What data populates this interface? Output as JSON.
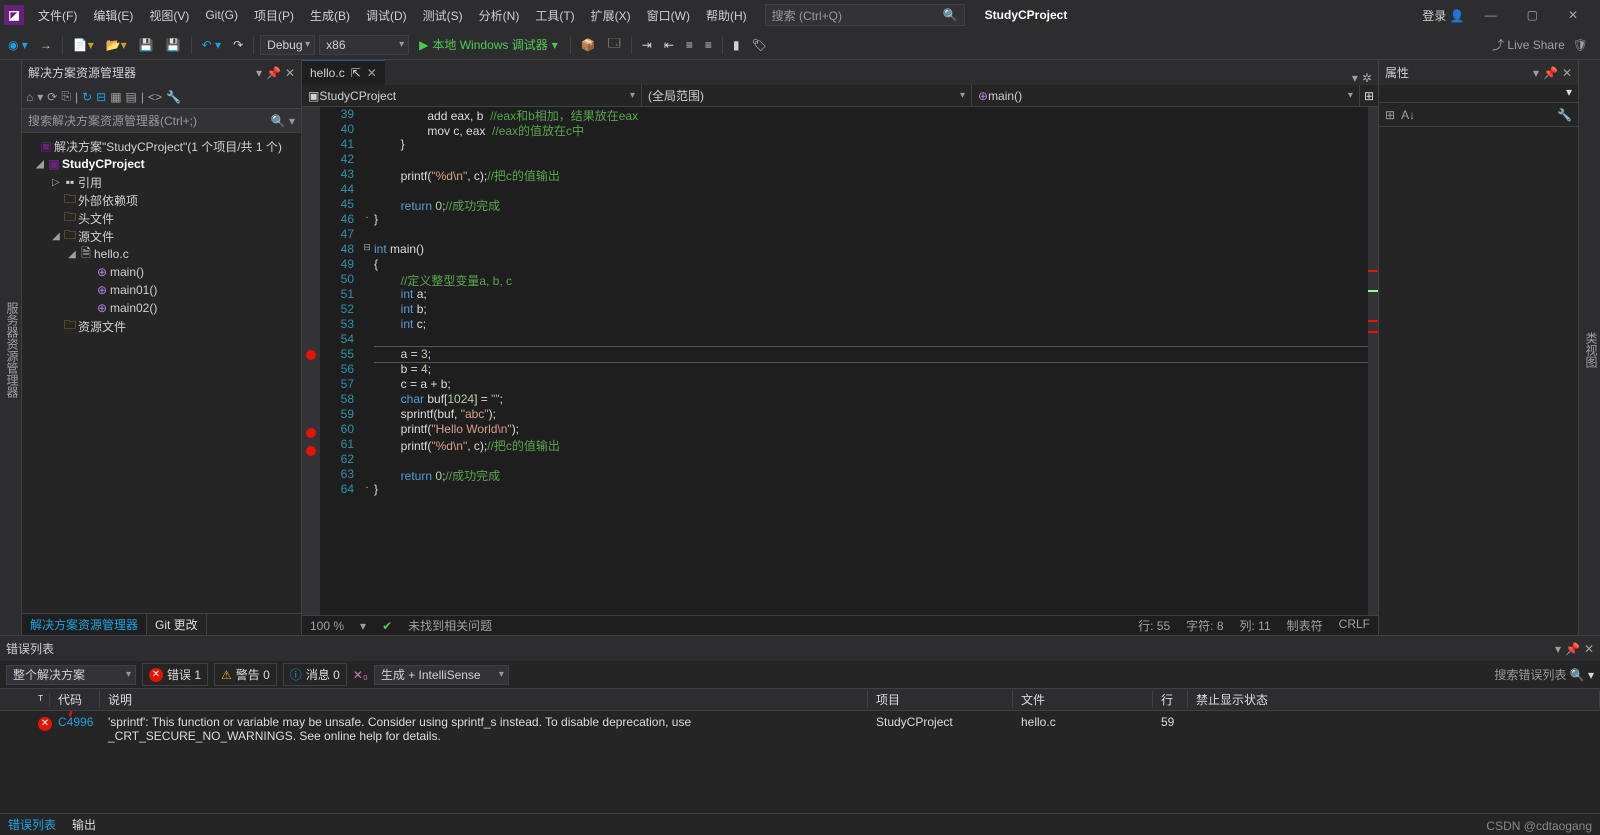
{
  "menu": {
    "file": "文件(F)",
    "edit": "编辑(E)",
    "view": "视图(V)",
    "git": "Git(G)",
    "project": "项目(P)",
    "build": "生成(B)",
    "debug": "调试(D)",
    "test": "测试(S)",
    "analyze": "分析(N)",
    "tools": "工具(T)",
    "extensions": "扩展(X)",
    "window": "窗口(W)",
    "help": "帮助(H)"
  },
  "searchPlaceholder": "搜索 (Ctrl+Q)",
  "projectName": "StudyCProject",
  "login": "登录",
  "toolbar": {
    "config": "Debug",
    "platform": "x86",
    "run": "本地 Windows 调试器"
  },
  "liveShare": "Live Share",
  "solExp": {
    "title": "解决方案资源管理器",
    "search": "搜索解决方案资源管理器(Ctrl+;)",
    "solution": "解决方案\"StudyCProject\"(1 个项目/共 1 个)",
    "project": "StudyCProject",
    "refs": "引用",
    "ext": "外部依赖项",
    "headers": "头文件",
    "src": "源文件",
    "file": "hello.c",
    "fn1": "main()",
    "fn2": "main01()",
    "fn3": "main02()",
    "res": "资源文件",
    "tab1": "解决方案资源管理器",
    "tab2": "Git 更改"
  },
  "editor": {
    "tab": "hello.c",
    "nav1": "StudyCProject",
    "nav2": "(全局范围)",
    "nav3": "main()",
    "zoom": "100 %",
    "issueStatus": "未找到相关问题",
    "statusLine": "行: 55",
    "statusChar": "字符: 8",
    "statusCol": "列: 11",
    "statusTab": "制表符",
    "statusCrlf": "CRLF"
  },
  "code": [
    {
      "ln": 39,
      "pre": "                ",
      "t": [
        {
          "c": "fn",
          "s": "add eax, b  "
        },
        {
          "c": "cmt",
          "s": "//eax和b相加，结果放在eax"
        }
      ]
    },
    {
      "ln": 40,
      "pre": "                ",
      "t": [
        {
          "c": "fn",
          "s": "mov c, eax  "
        },
        {
          "c": "cmt",
          "s": "//eax的值放在c中"
        }
      ]
    },
    {
      "ln": 41,
      "pre": "        ",
      "t": [
        {
          "c": "fn",
          "s": "}"
        }
      ]
    },
    {
      "ln": 42,
      "pre": "",
      "t": []
    },
    {
      "ln": 43,
      "pre": "        ",
      "t": [
        {
          "c": "fn",
          "s": "printf("
        },
        {
          "c": "str",
          "s": "\"%d\\n\""
        },
        {
          "c": "fn",
          "s": ", c);"
        },
        {
          "c": "cmt",
          "s": "//把c的值输出"
        }
      ]
    },
    {
      "ln": 44,
      "pre": "",
      "t": []
    },
    {
      "ln": 45,
      "pre": "        ",
      "t": [
        {
          "c": "kw",
          "s": "return"
        },
        {
          "c": "fn",
          "s": " "
        },
        {
          "c": "num",
          "s": "0"
        },
        {
          "c": "fn",
          "s": ";"
        },
        {
          "c": "cmt",
          "s": "//成功完成"
        }
      ]
    },
    {
      "ln": 46,
      "fold": "-",
      "pre": "",
      "t": [
        {
          "c": "fn",
          "s": "}"
        }
      ]
    },
    {
      "ln": 47,
      "pre": "",
      "t": []
    },
    {
      "ln": 48,
      "fold": "⊟",
      "pre": "",
      "t": [
        {
          "c": "kw",
          "s": "int"
        },
        {
          "c": "fn",
          "s": " main()"
        }
      ]
    },
    {
      "ln": 49,
      "pre": "",
      "t": [
        {
          "c": "fn",
          "s": "{"
        }
      ]
    },
    {
      "ln": 50,
      "pre": "        ",
      "t": [
        {
          "c": "cmt",
          "s": "//定义整型变量a, b, c"
        }
      ]
    },
    {
      "ln": 51,
      "pre": "        ",
      "t": [
        {
          "c": "kw",
          "s": "int"
        },
        {
          "c": "fn",
          "s": " a;"
        }
      ]
    },
    {
      "ln": 52,
      "pre": "        ",
      "t": [
        {
          "c": "kw",
          "s": "int"
        },
        {
          "c": "fn",
          "s": " b;"
        }
      ]
    },
    {
      "ln": 53,
      "pre": "        ",
      "t": [
        {
          "c": "kw",
          "s": "int"
        },
        {
          "c": "fn",
          "s": " c;"
        }
      ]
    },
    {
      "ln": 54,
      "pre": "",
      "t": []
    },
    {
      "ln": 55,
      "bp": true,
      "hl": true,
      "pre": "        ",
      "t": [
        {
          "c": "fn",
          "s": "a = "
        },
        {
          "c": "num",
          "s": "3"
        },
        {
          "c": "fn",
          "s": ";"
        }
      ]
    },
    {
      "ln": 56,
      "pre": "        ",
      "t": [
        {
          "c": "fn",
          "s": "b = "
        },
        {
          "c": "num",
          "s": "4"
        },
        {
          "c": "fn",
          "s": ";"
        }
      ]
    },
    {
      "ln": 57,
      "pre": "        ",
      "t": [
        {
          "c": "fn",
          "s": "c = a + b;"
        }
      ]
    },
    {
      "ln": 58,
      "pre": "        ",
      "t": [
        {
          "c": "kw",
          "s": "char"
        },
        {
          "c": "fn",
          "s": " buf["
        },
        {
          "c": "num",
          "s": "1024"
        },
        {
          "c": "fn",
          "s": "] = "
        },
        {
          "c": "str",
          "s": "\"\""
        },
        {
          "c": "fn",
          "s": ";"
        }
      ]
    },
    {
      "ln": 59,
      "pre": "        ",
      "t": [
        {
          "c": "fn",
          "s": "sprintf(buf, "
        },
        {
          "c": "str",
          "s": "\"abc\""
        },
        {
          "c": "fn",
          "s": ");"
        }
      ]
    },
    {
      "ln": 60,
      "bp": true,
      "pre": "        ",
      "t": [
        {
          "c": "fn",
          "s": "printf("
        },
        {
          "c": "str",
          "s": "\"Hello World\\n\""
        },
        {
          "c": "fn",
          "s": ");"
        }
      ]
    },
    {
      "ln": 61,
      "bp": true,
      "pre": "        ",
      "t": [
        {
          "c": "fn",
          "s": "printf("
        },
        {
          "c": "str",
          "s": "\"%d\\n\""
        },
        {
          "c": "fn",
          "s": ", c);"
        },
        {
          "c": "cmt",
          "s": "//把c的值输出"
        }
      ]
    },
    {
      "ln": 62,
      "pre": "",
      "t": []
    },
    {
      "ln": 63,
      "pre": "        ",
      "t": [
        {
          "c": "kw",
          "s": "return"
        },
        {
          "c": "fn",
          "s": " "
        },
        {
          "c": "num",
          "s": "0"
        },
        {
          "c": "fn",
          "s": ";"
        },
        {
          "c": "cmt",
          "s": "//成功完成"
        }
      ]
    },
    {
      "ln": 64,
      "fold": "-",
      "pre": "",
      "t": [
        {
          "c": "fn",
          "s": "}"
        }
      ]
    }
  ],
  "props": {
    "title": "属性"
  },
  "errorList": {
    "title": "错误列表",
    "scope": "整个解决方案",
    "err": "错误 1",
    "warn": "警告 0",
    "info": "消息 0",
    "build": "生成 + IntelliSense",
    "search": "搜索错误列表",
    "hdr": {
      "code": "代码",
      "desc": "说明",
      "proj": "项目",
      "file": "文件",
      "line": "行",
      "supp": "禁止显示状态"
    },
    "row": {
      "code": "C4996",
      "desc": "'sprintf': This function or variable may be unsafe. Consider using sprintf_s instead. To disable deprecation, use _CRT_SECURE_NO_WARNINGS. See online help for details.",
      "proj": "StudyCProject",
      "file": "hello.c",
      "line": "59"
    },
    "tab1": "错误列表",
    "tab2": "输出"
  },
  "watermark": "CSDN @cdtaogang"
}
